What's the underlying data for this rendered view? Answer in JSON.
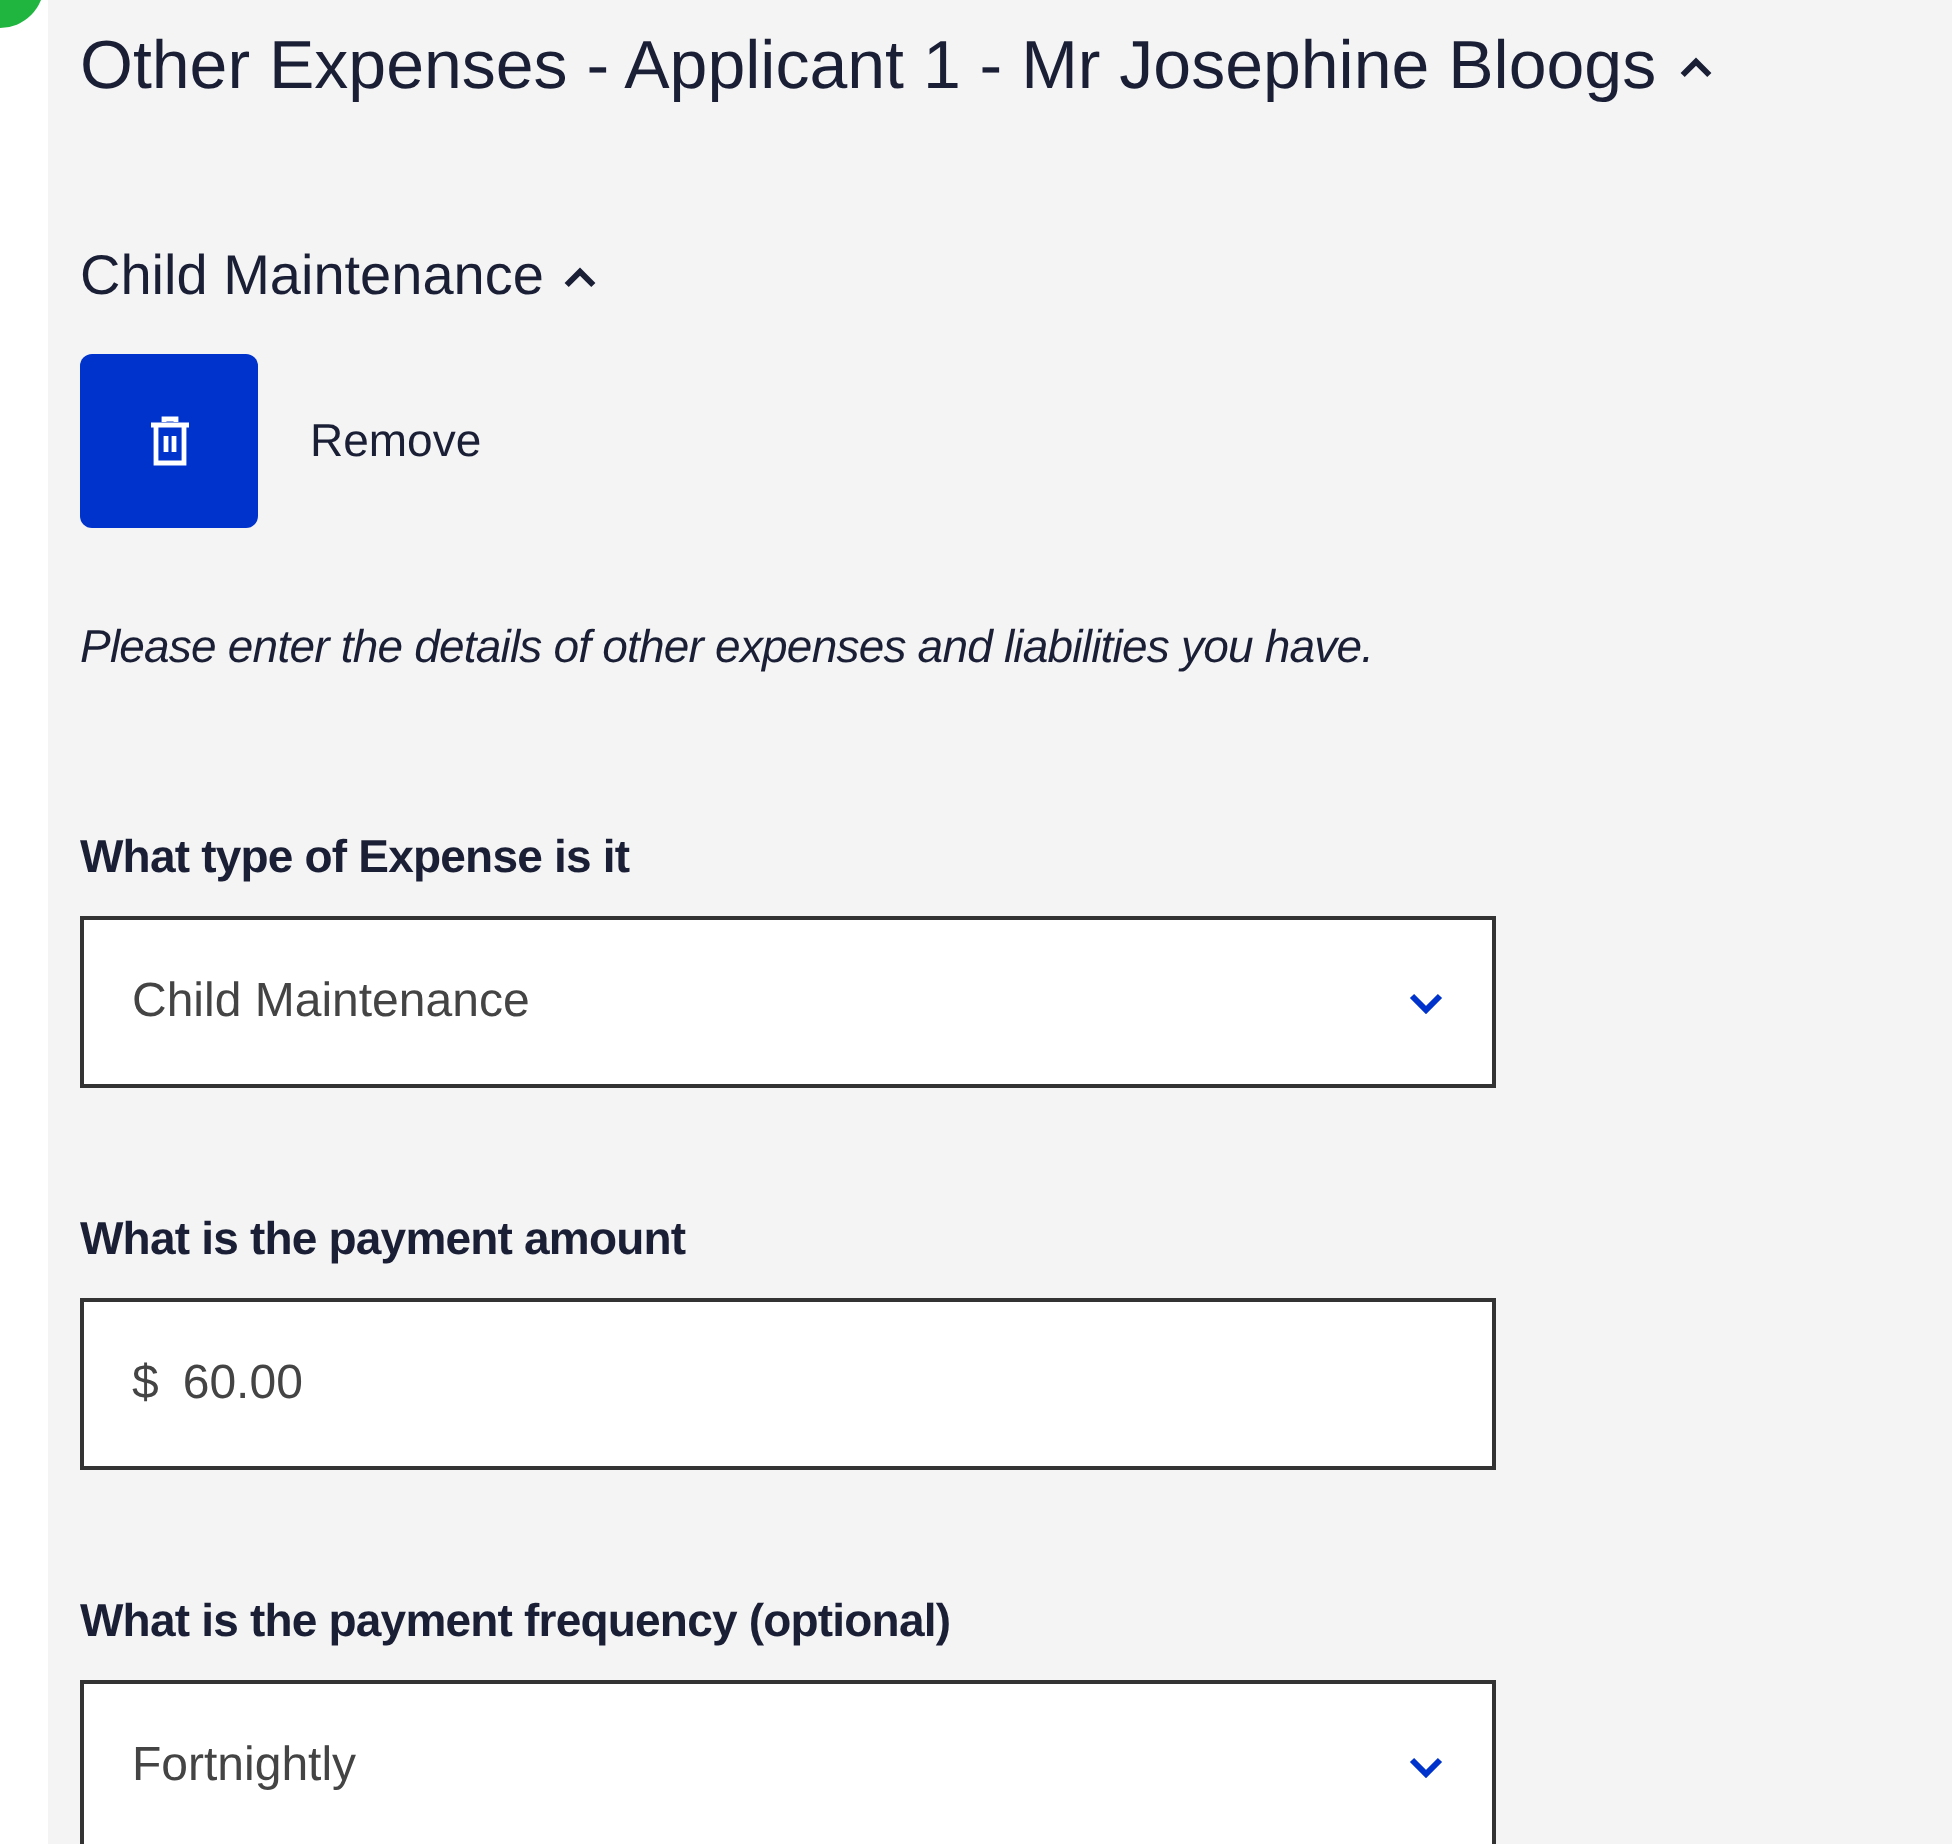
{
  "section": {
    "title": "Other Expenses - Applicant 1 - Mr Josephine Bloogs",
    "expanded": true
  },
  "item": {
    "title": "Child Maintenance",
    "expanded": true
  },
  "remove_button": {
    "label": "Remove"
  },
  "instructions": "Please enter the details of other expenses and liabilities you have.",
  "fields": [
    {
      "kind": "select",
      "label": "What type of Expense is it",
      "value": "Child Maintenance"
    },
    {
      "kind": "currency",
      "label": "What is the payment amount",
      "prefix": "$",
      "value": "60.00"
    },
    {
      "kind": "select",
      "label": "What is the payment frequency (optional)",
      "value": "Fortnightly"
    }
  ]
}
